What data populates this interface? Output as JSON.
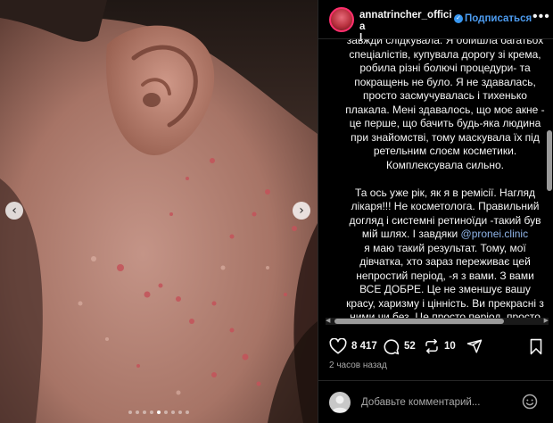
{
  "media": {
    "dots_count": 9,
    "active_dot": 4
  },
  "header": {
    "username": "annatrincher_officia\nl",
    "follow_label": "Подписаться",
    "more_label": "•••"
  },
  "caption": {
    "part1": "завжди слідкувала. Я обійшла багатьох спеціалістів, купувала дорогу зі крема, робила різні болючі процедури- та покращень не було. Я не здавалась, просто засмучувалась і тихенько плакала. Мені здавалось, що моє акне - це перше, що бачить будь-яка людина при знайомстві, тому маскувала їх під ретельним слоєм косметики. Комплексувала сильно.\n\nТа ось уже рік, як я в ремісії. Нагляд лікаря!!! Не косметолога. Правильний догляд і системні ретиноїди -такий був мій шлях. І завдяки ",
    "mention": "@pronei.clinic",
    "part2": "\nя маю такий результат. Тому, мої дівчатка, хто зараз переживає цей непростий період, -я з вами. З вами ВСЕ ДОБРЕ. Це не зменшує вашу красу, харизму і цінність. Ви прекрасні з ними чи без. Це просто період, просто шлях, який точно закінчиться"
  },
  "actions": {
    "likes": "8 417",
    "comments": "52",
    "reposts": "10"
  },
  "time": "2 часов назад",
  "comment": {
    "placeholder": "Добавьте комментарий..."
  },
  "colors": {
    "background": "#000000",
    "follow": "#4d9cf0",
    "mention": "#8fb4e8",
    "verified": "#3897f0"
  }
}
